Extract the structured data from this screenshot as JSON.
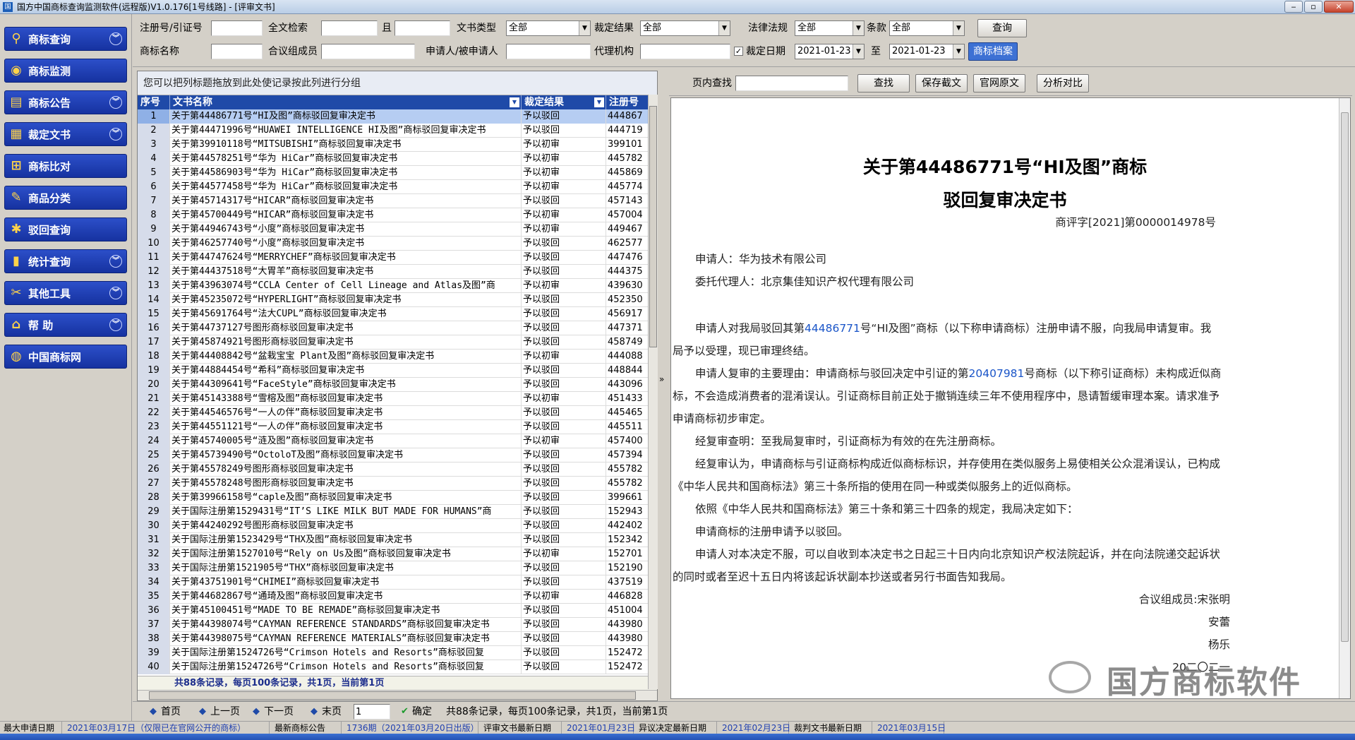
{
  "window": {
    "title": "国方中国商标查询监测软件(远程版)V1.0.176[1号线路] - [评审文书]",
    "app_icon": "国"
  },
  "sidebar": {
    "items": [
      {
        "label": "商标查询",
        "icon": "magnifier-icon",
        "glyph": "⚲",
        "chevron": true
      },
      {
        "label": "商标监测",
        "icon": "monitor-globe-icon",
        "glyph": "◉",
        "chevron": false
      },
      {
        "label": "商标公告",
        "icon": "notice-icon",
        "glyph": "▤",
        "chevron": true
      },
      {
        "label": "裁定文书",
        "icon": "document-icon",
        "glyph": "▦",
        "chevron": true
      },
      {
        "label": "商标比对",
        "icon": "compare-icon",
        "glyph": "⊞",
        "chevron": false
      },
      {
        "label": "商品分类",
        "icon": "category-icon",
        "glyph": "✎",
        "chevron": false
      },
      {
        "label": "驳回查询",
        "icon": "reject-icon",
        "glyph": "✱",
        "chevron": false
      },
      {
        "label": "统计查询",
        "icon": "statistics-icon",
        "glyph": "▮",
        "chevron": true
      },
      {
        "label": "其他工具",
        "icon": "tools-icon",
        "glyph": "✂",
        "chevron": true
      },
      {
        "label": "帮    助",
        "icon": "help-icon",
        "glyph": "⌂",
        "chevron": true
      },
      {
        "label": "中国商标网",
        "icon": "globe-icon",
        "glyph": "◍",
        "chevron": false
      }
    ]
  },
  "search": {
    "reg_no_label": "注册号/引证号",
    "reg_no_value": "",
    "fulltext_label": "全文检索",
    "fulltext_value": "",
    "and_label": "且",
    "and_value": "",
    "doctype_label": "文书类型",
    "doctype_value": "全部",
    "ruling_label": "裁定结果",
    "ruling_value": "全部",
    "law_label": "法律法规",
    "law_value": "全部",
    "clause_label": "条款",
    "clause_value": "全部",
    "query_button": "查询",
    "name_label": "商标名称",
    "name_value": "",
    "panel_label": "合议组成员",
    "panel_value": "",
    "applicant_label": "申请人/被申请人",
    "applicant_value": "",
    "agency_label": "代理机构",
    "agency_value": "",
    "date_checked": true,
    "date_label": "裁定日期",
    "date_from": "2021-01-23",
    "to_label": "至",
    "date_to": "2021-01-23",
    "archive_button": "商标档案"
  },
  "grid": {
    "group_hint": "您可以把列标题拖放到此处使记录按此列进行分组",
    "columns": [
      "序号",
      "文书名称",
      "裁定结果",
      "注册号"
    ],
    "rows": [
      [
        "1",
        "关于第44486771号“HI及图”商标驳回复审决定书",
        "予以驳回",
        "444867"
      ],
      [
        "2",
        "关于第44471996号“HUAWEI INTELLIGENCE HI及图”商标驳回复审决定书",
        "予以驳回",
        "444719"
      ],
      [
        "3",
        "关于第39910118号“MITSUBISHI”商标驳回复审决定书",
        "予以初审",
        "399101"
      ],
      [
        "4",
        "关于第44578251号“华为 HiCar”商标驳回复审决定书",
        "予以初审",
        "445782"
      ],
      [
        "5",
        "关于第44586903号“华为 HiCar”商标驳回复审决定书",
        "予以初审",
        "445869"
      ],
      [
        "6",
        "关于第44577458号“华为 HiCar”商标驳回复审决定书",
        "予以初审",
        "445774"
      ],
      [
        "7",
        "关于第45714317号“HICAR”商标驳回复审决定书",
        "予以驳回",
        "457143"
      ],
      [
        "8",
        "关于第45700449号“HICAR”商标驳回复审决定书",
        "予以初审",
        "457004"
      ],
      [
        "9",
        "关于第44946743号“小度”商标驳回复审决定书",
        "予以初审",
        "449467"
      ],
      [
        "10",
        "关于第46257740号“小度”商标驳回复审决定书",
        "予以驳回",
        "462577"
      ],
      [
        "11",
        "关于第44747624号“MERRYCHEF”商标驳回复审决定书",
        "予以驳回",
        "447476"
      ],
      [
        "12",
        "关于第44437518号“大胃羊”商标驳回复审决定书",
        "予以驳回",
        "444375"
      ],
      [
        "13",
        "关于第43963074号“CCLA Center of Cell Lineage and Atlas及图”商",
        "予以初审",
        "439630"
      ],
      [
        "14",
        "关于第45235072号“HYPERLIGHT”商标驳回复审决定书",
        "予以驳回",
        "452350"
      ],
      [
        "15",
        "关于第45691764号“法大CUPL”商标驳回复审决定书",
        "予以驳回",
        "456917"
      ],
      [
        "16",
        "关于第44737127号图形商标驳回复审决定书",
        "予以驳回",
        "447371"
      ],
      [
        "17",
        "关于第45874921号图形商标驳回复审决定书",
        "予以驳回",
        "458749"
      ],
      [
        "18",
        "关于第44408842号“盆栽宝宝 Plant及图”商标驳回复审决定书",
        "予以初审",
        "444088"
      ],
      [
        "19",
        "关于第44884454号“希科”商标驳回复审决定书",
        "予以驳回",
        "448844"
      ],
      [
        "20",
        "关于第44309641号“FaceStyle”商标驳回复审决定书",
        "予以驳回",
        "443096"
      ],
      [
        "21",
        "关于第45143388号“雪榕及图”商标驳回复审决定书",
        "予以初审",
        "451433"
      ],
      [
        "22",
        "关于第44546576号“一人の伴”商标驳回复审决定书",
        "予以驳回",
        "445465"
      ],
      [
        "23",
        "关于第44551121号“一人の伴”商标驳回复审决定书",
        "予以驳回",
        "445511"
      ],
      [
        "24",
        "关于第45740005号“涟及图”商标驳回复审决定书",
        "予以初审",
        "457400"
      ],
      [
        "25",
        "关于第45739490号“OctoloT及图”商标驳回复审决定书",
        "予以驳回",
        "457394"
      ],
      [
        "26",
        "关于第45578249号图形商标驳回复审决定书",
        "予以驳回",
        "455782"
      ],
      [
        "27",
        "关于第45578248号图形商标驳回复审决定书",
        "予以驳回",
        "455782"
      ],
      [
        "28",
        "关于第39966158号“caple及图”商标驳回复审决定书",
        "予以驳回",
        "399661"
      ],
      [
        "29",
        "关于国际注册第1529431号“IT’S LIKE MILK BUT MADE FOR HUMANS”商",
        "予以驳回",
        "152943"
      ],
      [
        "30",
        "关于第44240292号图形商标驳回复审决定书",
        "予以驳回",
        "442402"
      ],
      [
        "31",
        "关于国际注册第1523429号“THX及图”商标驳回复审决定书",
        "予以驳回",
        "152342"
      ],
      [
        "32",
        "关于国际注册第1527010号“Rely on Us及图”商标驳回复审决定书",
        "予以初审",
        "152701"
      ],
      [
        "33",
        "关于国际注册第1521905号“THX”商标驳回复审决定书",
        "予以驳回",
        "152190"
      ],
      [
        "34",
        "关于第43751901号“CHIMEI”商标驳回复审决定书",
        "予以驳回",
        "437519"
      ],
      [
        "35",
        "关于第44682867号“通琦及图”商标驳回复审决定书",
        "予以初审",
        "446828"
      ],
      [
        "36",
        "关于第45100451号“MADE TO BE REMADE”商标驳回复审决定书",
        "予以驳回",
        "451004"
      ],
      [
        "37",
        "关于第44398074号“CAYMAN REFERENCE STANDARDS”商标驳回复审决定书",
        "予以驳回",
        "443980"
      ],
      [
        "38",
        "关于第44398075号“CAYMAN REFERENCE MATERIALS”商标驳回复审决定书",
        "予以驳回",
        "443980"
      ],
      [
        "39",
        "关于国际注册第1524726号“Crimson Hotels and Resorts”商标驳回复",
        "予以驳回",
        "152472"
      ],
      [
        "40",
        "关于国际注册第1524726号“Crimson Hotels and Resorts”商标驳回复",
        "予以驳回",
        "152472"
      ]
    ],
    "footer": "共88条记录，每页100条记录，共1页，当前第1页"
  },
  "doc_toolbar": {
    "find_label": "页内查找",
    "find_value": "",
    "find_button": "查找",
    "save_button": "保存截文",
    "original_button": "官网原文",
    "compare_button": "分析对比"
  },
  "document": {
    "title1": "关于第44486771号“HI及图”商标",
    "title2": "驳回复审决定书",
    "ref": "商评字[2021]第0000014978号",
    "applicant": "申请人：华为技术有限公司",
    "agent": "委托代理人：北京集佳知识产权代理有限公司",
    "p1_pre": "申请人对我局驳回其第",
    "p1_link": "44486771",
    "p1_post": "号“HI及图”商标（以下称申请商标）注册申请不服，向我局申请复审。我局予以受理，现已审理终结。",
    "p2_pre": "申请人复审的主要理由：申请商标与驳回决定中引证的第",
    "p2_link": "20407981",
    "p2_post": "号商标（以下称引证商标）未构成近似商标，不会造成消费者的混淆误认。引证商标目前正处于撤销连续三年不使用程序中，恳请暂缓审理本案。请求准予申请商标初步审定。",
    "p3": "经复审查明：至我局复审时，引证商标为有效的在先注册商标。",
    "p4": "经复审认为，申请商标与引证商标构成近似商标标识，并存使用在类似服务上易使相关公众混淆误认，已构成《中华人民共和国商标法》第三十条所指的使用在同一种或类似服务上的近似商标。",
    "p5": "依照《中华人民共和国商标法》第三十条和第三十四条的规定，我局决定如下：",
    "p6": "申请商标的注册申请予以驳回。",
    "p7": "申请人对本决定不服，可以自收到本决定书之日起三十日内向北京知识产权法院起诉，并在向法院递交起诉状的同时或者至迟十五日内将该起诉状副本抄送或者另行书面告知我局。",
    "sig1": "合议组成员:宋张明",
    "sig2": "安蕾",
    "sig3": "杨乐",
    "date": "20二〇二一",
    "watermark": "国方商标软件"
  },
  "nav": {
    "first": "首页",
    "prev": "上一页",
    "next": "下一页",
    "last": "末页",
    "page_value": "1",
    "confirm": "确定",
    "info": "共88条记录，每页100条记录，共1页，当前第1页"
  },
  "status": [
    {
      "text": "最大申请日期",
      "blue": false
    },
    {
      "text": "2021年03月17日（仅限已在官网公开的商标）",
      "blue": true
    },
    {
      "text": "最新商标公告",
      "blue": false
    },
    {
      "text": "1736期（2021年03月20日出版）",
      "blue": true
    },
    {
      "text": "评审文书最新日期",
      "blue": false
    },
    {
      "text": "2021年01月23日",
      "blue": true
    },
    {
      "text": "异议决定最新日期",
      "blue": false
    },
    {
      "text": "2021年02月23日",
      "blue": true
    },
    {
      "text": "裁判文书最新日期",
      "blue": false
    },
    {
      "text": "2021年03月15日",
      "blue": true
    }
  ],
  "colors": {
    "selection": "#b6cdf2",
    "header": "#1f4aa8",
    "sidebar": "#1f3fb5",
    "link": "#1a55c8"
  }
}
